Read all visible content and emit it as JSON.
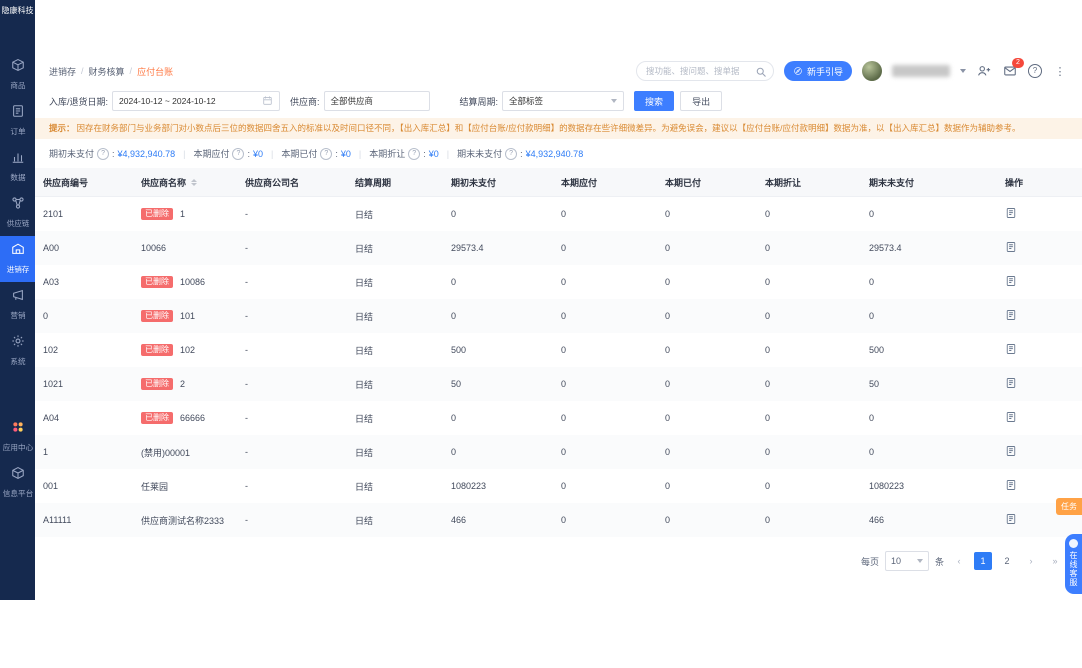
{
  "app": {
    "logo_text": "隐康科技"
  },
  "colors": {
    "accent": "#3d7eff",
    "danger": "#f56c6c",
    "warning_text": "#d98a33",
    "sidebar_bg": "#15294e"
  },
  "sidebar": {
    "items": [
      {
        "label": "商品"
      },
      {
        "label": "订单"
      },
      {
        "label": "数据"
      },
      {
        "label": "供应链"
      },
      {
        "label": "进销存",
        "active": true
      },
      {
        "label": "营销"
      },
      {
        "label": "系统"
      },
      {
        "label": "应用中心"
      },
      {
        "label": "信息平台"
      }
    ]
  },
  "breadcrumb": {
    "l1": "进销存",
    "l2": "财务核算",
    "l3": "应付台账",
    "separator": "/"
  },
  "topbar": {
    "search_placeholder": "搜功能、搜问题、搜单据",
    "guide_button": "新手引导",
    "message_badge": "2"
  },
  "filters": {
    "date_label": "入库/退货日期:",
    "date_value": "2024-10-12 ~ 2024-10-12",
    "supplier_label": "供应商:",
    "supplier_value": "全部供应商",
    "cycle_label": "结算周期:",
    "cycle_value": "全部标签",
    "search_button": "搜索",
    "export_button": "导出"
  },
  "notice": {
    "prefix": "提示：",
    "text": "因存在财务部门与业务部门对小数点后三位的数据四舍五入的标准以及时间口径不同，【出入库汇总】和【应付台账/应付款明细】的数据存在些许细微差异。为避免误会，建议以【应付台账/应付款明细】数据为准，以【出入库汇总】数据作为辅助参考。"
  },
  "summary": {
    "colon": ":",
    "separator": "|",
    "items": [
      {
        "label": "期初未支付",
        "value": "¥4,932,940.78"
      },
      {
        "label": "本期应付",
        "value": "¥0"
      },
      {
        "label": "本期已付",
        "value": "¥0"
      },
      {
        "label": "本期折让",
        "value": "¥0"
      },
      {
        "label": "期末未支付",
        "value": "¥4,932,940.78"
      }
    ]
  },
  "table": {
    "deleted_tag": "已删除",
    "column_keys": [
      "no",
      "name",
      "company",
      "cycle",
      "opening",
      "payable",
      "paid",
      "discount",
      "ending",
      "action"
    ],
    "headers": [
      "供应商编号",
      "供应商名称",
      "供应商公司名",
      "结算周期",
      "期初未支付",
      "本期应付",
      "本期已付",
      "本期折让",
      "期末未支付",
      "操作"
    ],
    "rows": [
      {
        "no": "2101",
        "deleted": true,
        "name": "1",
        "company": "-",
        "cycle": "日结",
        "opening": "0",
        "payable": "0",
        "paid": "0",
        "discount": "0",
        "ending": "0"
      },
      {
        "no": "A00",
        "deleted": false,
        "name": "10066",
        "company": "-",
        "cycle": "日结",
        "opening": "29573.4",
        "payable": "0",
        "paid": "0",
        "discount": "0",
        "ending": "29573.4"
      },
      {
        "no": "A03",
        "deleted": true,
        "name": "10086",
        "company": "-",
        "cycle": "日结",
        "opening": "0",
        "payable": "0",
        "paid": "0",
        "discount": "0",
        "ending": "0"
      },
      {
        "no": "0",
        "deleted": true,
        "name": "101",
        "company": "-",
        "cycle": "日结",
        "opening": "0",
        "payable": "0",
        "paid": "0",
        "discount": "0",
        "ending": "0"
      },
      {
        "no": "102",
        "deleted": true,
        "name": "102",
        "company": "-",
        "cycle": "日结",
        "opening": "500",
        "payable": "0",
        "paid": "0",
        "discount": "0",
        "ending": "500"
      },
      {
        "no": "1021",
        "deleted": true,
        "name": "2",
        "company": "-",
        "cycle": "日结",
        "opening": "50",
        "payable": "0",
        "paid": "0",
        "discount": "0",
        "ending": "50"
      },
      {
        "no": "A04",
        "deleted": true,
        "name": "66666",
        "company": "-",
        "cycle": "日结",
        "opening": "0",
        "payable": "0",
        "paid": "0",
        "discount": "0",
        "ending": "0"
      },
      {
        "no": "1",
        "deleted": false,
        "name": "(禁用)00001",
        "company": "-",
        "cycle": "日结",
        "opening": "0",
        "payable": "0",
        "paid": "0",
        "discount": "0",
        "ending": "0"
      },
      {
        "no": "001",
        "deleted": false,
        "name": "任莱园",
        "company": "-",
        "cycle": "日结",
        "opening": "1080223",
        "payable": "0",
        "paid": "0",
        "discount": "0",
        "ending": "1080223"
      },
      {
        "no": "A11111",
        "deleted": false,
        "name": "供应商测试名称2333",
        "company": "-",
        "cycle": "日结",
        "opening": "466",
        "payable": "0",
        "paid": "0",
        "discount": "0",
        "ending": "466"
      }
    ]
  },
  "pagination": {
    "per_page_label": "每页",
    "per_page_value": "10",
    "per_page_unit": "条",
    "pages": [
      "1",
      "2"
    ],
    "active_page": "1"
  },
  "floating": {
    "task_tab": "任务",
    "service_tab": "在线客服"
  }
}
